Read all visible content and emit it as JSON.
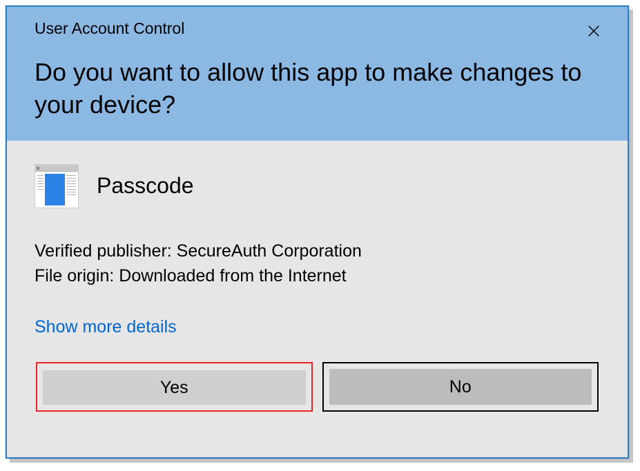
{
  "window": {
    "title": "User Account Control",
    "question": "Do you want to allow this app to make changes to your device?"
  },
  "app": {
    "name": "Passcode"
  },
  "details": {
    "publisher_line": "Verified publisher: SecureAuth Corporation",
    "origin_line": "File origin: Downloaded from the Internet"
  },
  "links": {
    "show_more": "Show more details"
  },
  "buttons": {
    "yes": "Yes",
    "no": "No"
  }
}
